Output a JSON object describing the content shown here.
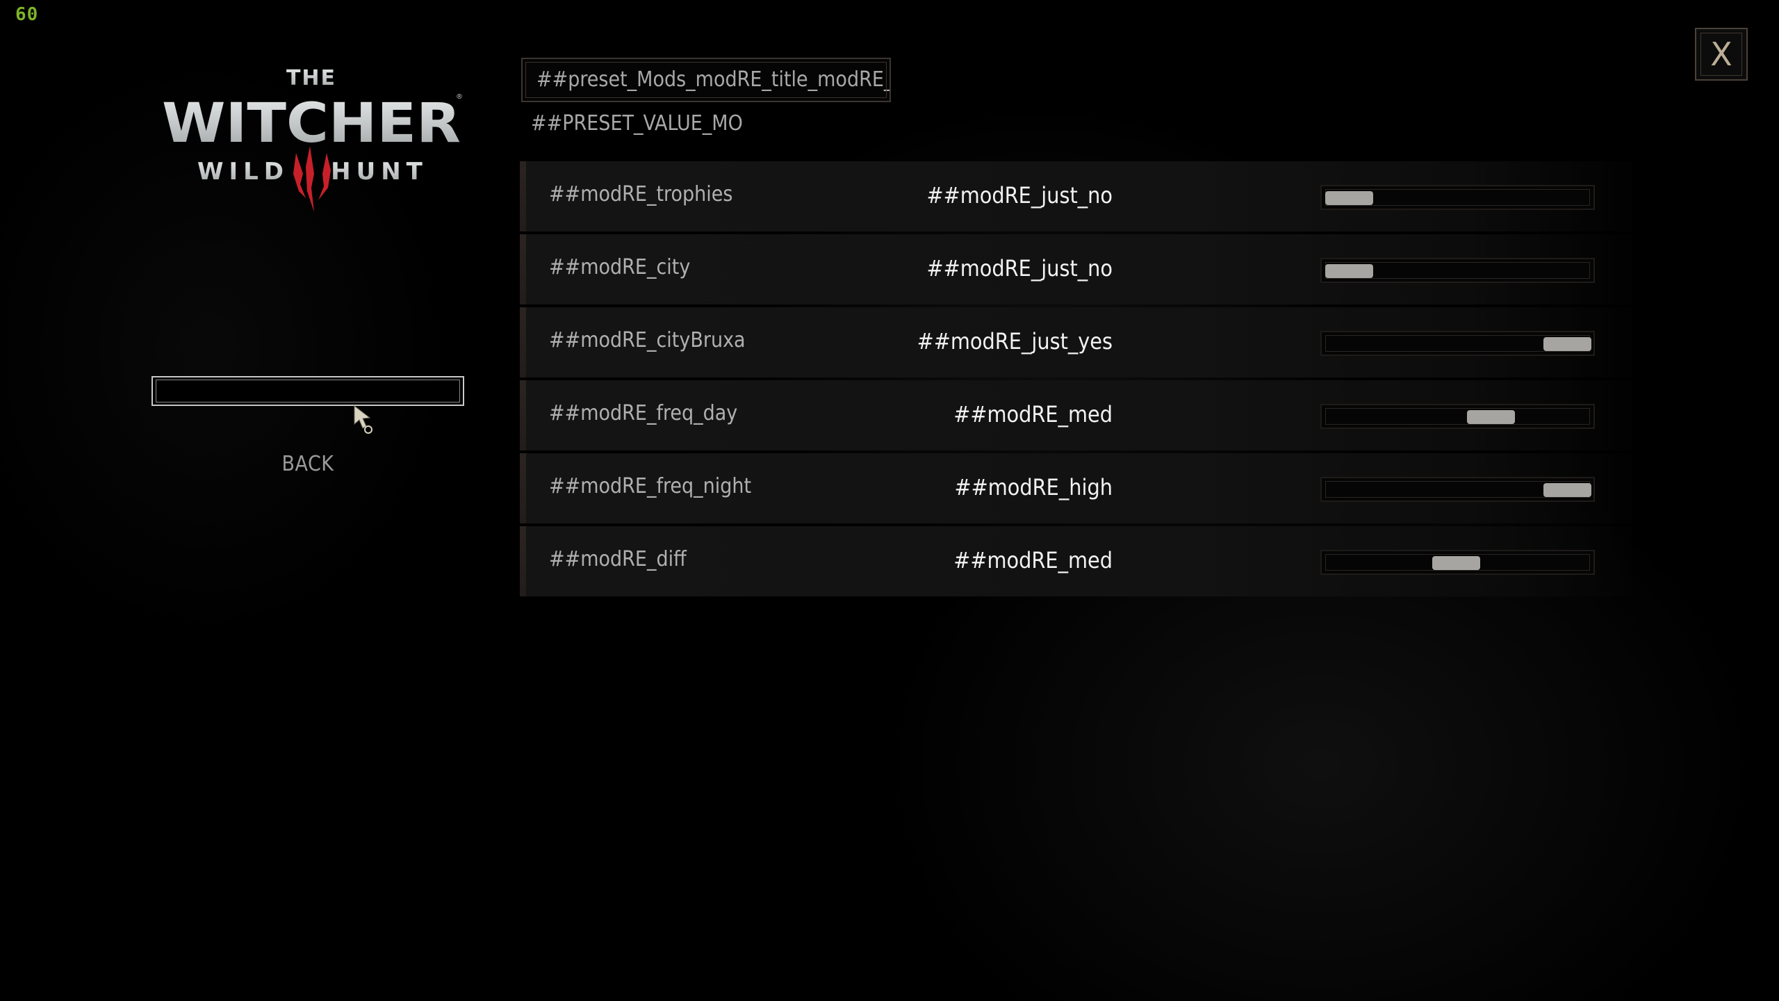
{
  "fps_counter": "60",
  "logo": {
    "line1": "THE",
    "line2": "WITCHER",
    "line3_left": "WILD",
    "line3_right": "HUNT",
    "accent_color": "#c8202a"
  },
  "left_menu": {
    "selected_item_label": "",
    "back_label": "BACK"
  },
  "header": {
    "preset_title": "##preset_Mods_modRE_title_modRE_main",
    "preset_value": "##PRESET_VALUE_MO"
  },
  "options": [
    {
      "label": "##modRE_trophies",
      "value": "##modRE_just_no",
      "slider_position": 0.0
    },
    {
      "label": "##modRE_city",
      "value": "##modRE_just_no",
      "slider_position": 0.0
    },
    {
      "label": "##modRE_cityBruxa",
      "value": "##modRE_just_yes",
      "slider_position": 1.0
    },
    {
      "label": "##modRE_freq_day",
      "value": "##modRE_med",
      "slider_position": 0.65
    },
    {
      "label": "##modRE_freq_night",
      "value": "##modRE_high",
      "slider_position": 1.0
    },
    {
      "label": "##modRE_diff",
      "value": "##modRE_med",
      "slider_position": 0.49
    }
  ],
  "close_button": {
    "label": "X",
    "icon": "close-icon"
  },
  "colors": {
    "fps": "#7cb32a",
    "slider_thumb": "#a6a5a2",
    "close_glyph": "#bcae96"
  }
}
